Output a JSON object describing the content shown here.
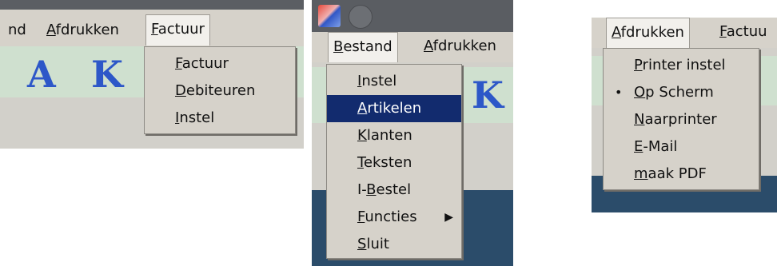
{
  "panel1": {
    "menubar": [
      "nd",
      "Afdrukken",
      "Factuur"
    ],
    "menu": [
      "Factuur",
      "Debiteuren",
      "Instel"
    ],
    "letters": [
      "A",
      "K"
    ]
  },
  "panel2": {
    "menubar": [
      "Bestand",
      "Afdrukken"
    ],
    "menu": [
      "Instel",
      "Artikelen",
      "Klanten",
      "Teksten",
      "I-Bestel",
      "Functies",
      "Sluit"
    ],
    "selected": "Artikelen",
    "letter": "K",
    "submenu_arrow": "▶"
  },
  "panel3": {
    "menubar": [
      "Afdrukken",
      "Factuu"
    ],
    "menu": [
      "Printer instel",
      "Op Scherm",
      "Naarprinter",
      "E-Mail",
      "maak PDF"
    ],
    "checked": "Op Scherm",
    "bullet": "•"
  },
  "colors": {
    "menu_bg": "#d6d2ca",
    "selection": "#122b6e",
    "letters": "#2d57c8",
    "green_bar": "#cfe0cf",
    "desktop": "#2b4c6a"
  }
}
